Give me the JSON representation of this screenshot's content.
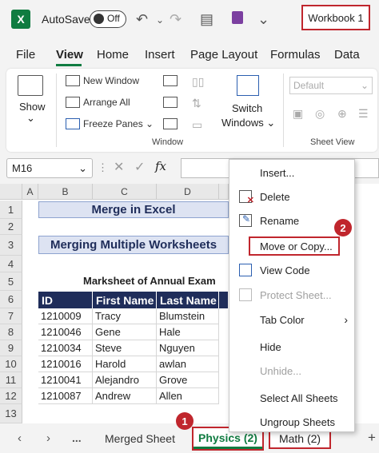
{
  "titlebar": {
    "app_icon": "X",
    "autosave_label": "AutoSave",
    "toggle_state": "Off",
    "workbook_title": "Workbook 1"
  },
  "menu": [
    "File",
    "View",
    "Home",
    "Insert",
    "Page Layout",
    "Formulas",
    "Data"
  ],
  "ribbon": {
    "show_label": "Show",
    "new_window": "New Window",
    "arrange_all": "Arrange All",
    "freeze_panes": "Freeze Panes",
    "switch_windows_1": "Switch",
    "switch_windows_2": "Windows",
    "window_group": "Window",
    "default_select": "Default",
    "sheet_view_group": "Sheet View"
  },
  "formula_bar": {
    "name_box": "M16",
    "fx": "fx"
  },
  "columns": [
    "A",
    "B",
    "C",
    "D"
  ],
  "rows": [
    "1",
    "2",
    "3",
    "4",
    "5",
    "6",
    "7",
    "8",
    "9",
    "10",
    "11",
    "12",
    "13"
  ],
  "sheet": {
    "banner1": "Merge in Excel",
    "banner2": "Merging Multiple Worksheets",
    "subtitle": "Marksheet of Annual Exam",
    "headers": [
      "ID",
      "First Name",
      "Last Name"
    ],
    "data": [
      [
        "1210009",
        "Tracy",
        "Blumstein"
      ],
      [
        "1210046",
        "Gene",
        "Hale"
      ],
      [
        "1210034",
        "Steve",
        "Nguyen"
      ],
      [
        "1210016",
        "Harold",
        "awlan"
      ],
      [
        "1210041",
        "Alejandro",
        "Grove"
      ],
      [
        "1210087",
        "Andrew",
        "Allen"
      ]
    ]
  },
  "context_menu": {
    "items": [
      {
        "label": "Insert...",
        "disabled": false
      },
      {
        "label": "Delete",
        "disabled": false
      },
      {
        "label": "Rename",
        "disabled": false
      },
      {
        "label": "Move or Copy...",
        "disabled": false
      },
      {
        "label": "View Code",
        "disabled": false
      },
      {
        "label": "Protect Sheet...",
        "disabled": true
      },
      {
        "label": "Tab Color",
        "disabled": false
      },
      {
        "label": "Hide",
        "disabled": false
      },
      {
        "label": "Unhide...",
        "disabled": true
      },
      {
        "label": "Select All Sheets",
        "disabled": false
      },
      {
        "label": "Ungroup Sheets",
        "disabled": false
      }
    ]
  },
  "sheet_tabs": {
    "more": "...",
    "tabs": [
      "Merged Sheet",
      "Physics (2)",
      "Math (2)"
    ],
    "add": "+"
  },
  "callouts": {
    "step1": "1",
    "step2": "2"
  },
  "colors": {
    "excel_green": "#107c41",
    "highlight_red": "#c0262d",
    "table_header": "#1f2d5a"
  }
}
